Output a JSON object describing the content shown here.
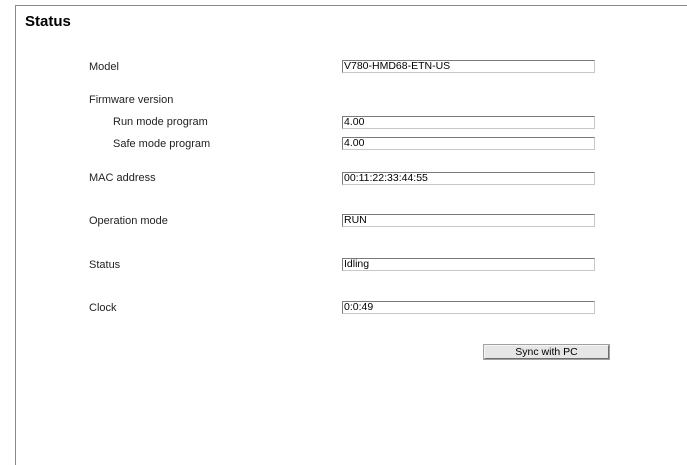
{
  "page": {
    "title": "Status"
  },
  "fields": {
    "model": {
      "label": "Model",
      "value": "V780-HMD68-ETN-US"
    },
    "firmware_heading": "Firmware version",
    "run_mode": {
      "label": "Run mode program",
      "value": "4.00"
    },
    "safe_mode": {
      "label": "Safe mode program",
      "value": "4.00"
    },
    "mac_address": {
      "label": "MAC address",
      "value": "00:11:22:33:44:55"
    },
    "operation_mode": {
      "label": "Operation mode",
      "value": "RUN"
    },
    "status": {
      "label": "Status",
      "value": "Idling"
    },
    "clock": {
      "label": "Clock",
      "value": "0:0:49"
    }
  },
  "actions": {
    "sync_label": "Sync with PC"
  }
}
